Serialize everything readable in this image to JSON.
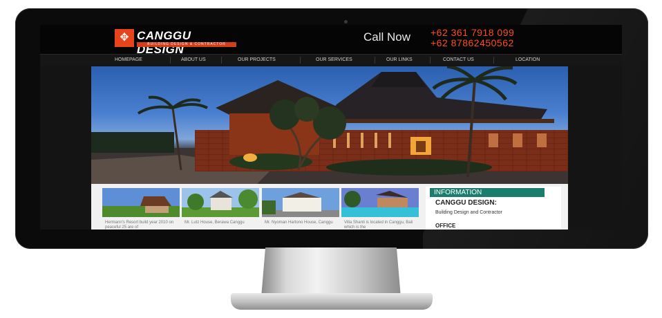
{
  "site": {
    "logo_text": "CANGGU DESIGN",
    "logo_tagline": "BUILDING DESIGN & CONTRACTOR",
    "call_label": "Call Now",
    "phones": [
      "+62 361 7918 099",
      "+62 87862450562"
    ]
  },
  "nav": {
    "items": [
      "HOMEPAGE",
      "ABOUT US",
      "OUR PROJECTS",
      "OUR SERVICES",
      "OUR LINKS",
      "CONTACT US",
      "LOCATION"
    ]
  },
  "projects": [
    {
      "caption": "Hermann's Resort build year 2010 on peaceful 25 are of",
      "icon": "resort-photo"
    },
    {
      "caption": "Mr. Lutz House, Berawa Canggu",
      "icon": "house-photo"
    },
    {
      "caption": "Mr. Nyoman Hartono House, Canggu",
      "icon": "house-photo"
    },
    {
      "caption": "Villa Shanti is located in Canggu, Bali which is the",
      "icon": "villa-pool-photo"
    }
  ],
  "info": {
    "title": "INFORMATION",
    "name": "CANGGU DESIGN:",
    "description": "Building Design and Contractor",
    "more": "OFFICE"
  },
  "colors": {
    "accent_orange": "#ff4d1a",
    "info_teal": "#1a7d6d",
    "header_bg": "#050505"
  }
}
